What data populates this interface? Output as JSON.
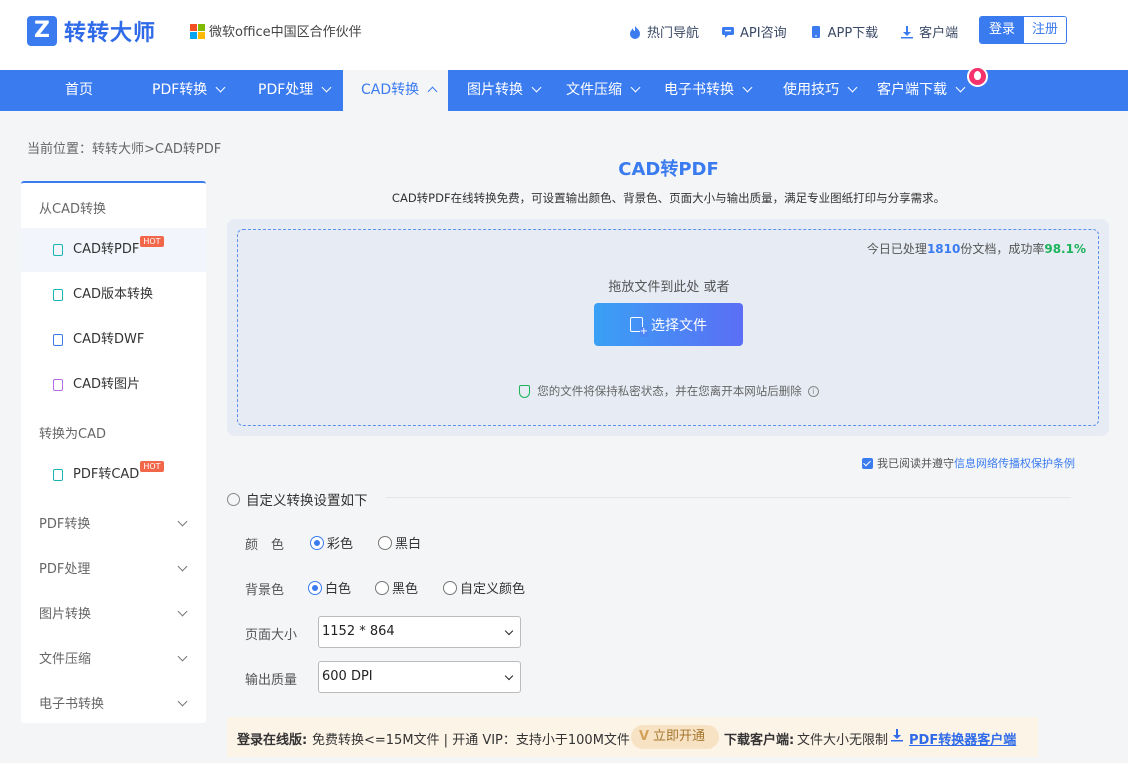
{
  "brand": {
    "name": "转转大师",
    "partner": "微软office中国区合作伙伴"
  },
  "top_links": [
    {
      "label": "热门导航",
      "icon": "fire-icon"
    },
    {
      "label": "API咨询",
      "icon": "chat-icon"
    },
    {
      "label": "APP下载",
      "icon": "phone-icon"
    },
    {
      "label": "客户端",
      "icon": "download-icon"
    }
  ],
  "auth": {
    "login": "登录",
    "register": "注册"
  },
  "nav": [
    {
      "label": "首页"
    },
    {
      "label": "PDF转换"
    },
    {
      "label": "PDF处理"
    },
    {
      "label": "CAD转换"
    },
    {
      "label": "图片转换"
    },
    {
      "label": "文件压缩"
    },
    {
      "label": "电子书转换"
    },
    {
      "label": "使用技巧"
    },
    {
      "label": "客户端下载"
    }
  ],
  "breadcrumb": "当前位置：转转大师>CAD转PDF",
  "sidebar": {
    "group1": "从CAD转换",
    "items1": [
      {
        "label": "CAD转PDF",
        "hot": "HOT"
      },
      {
        "label": "CAD版本转换"
      },
      {
        "label": "CAD转DWF"
      },
      {
        "label": "CAD转图片"
      }
    ],
    "group2": "转换为CAD",
    "items2": [
      {
        "label": "PDF转CAD",
        "hot": "HOT"
      }
    ],
    "collapsed": [
      "PDF转换",
      "PDF处理",
      "图片转换",
      "文件压缩",
      "电子书转换"
    ]
  },
  "main": {
    "title": "CAD转PDF",
    "desc": "CAD转PDF在线转换免费，可设置输出颜色、背景色、页面大小与输出质量，满足专业图纸打印与分享需求。",
    "stats": {
      "prefix": "今日已处理",
      "count": "1810",
      "mid": "份文档，成功率",
      "rate": "98.1%"
    },
    "drop_hint": "拖放文件到此处 或者",
    "select_button": "选择文件",
    "privacy": "您的文件将保持私密状态，并在您离开本网站后删除",
    "agree_prefix": "我已阅读并遵守",
    "agree_link": "信息网络传播权保护条例",
    "settings_title": "自定义转换设置如下",
    "color": {
      "label": "颜　色",
      "options": [
        "彩色",
        "黑白"
      ],
      "selected": "彩色"
    },
    "bg": {
      "label": "背景色",
      "options": [
        "白色",
        "黑色",
        "自定义颜色"
      ],
      "selected": "白色"
    },
    "page_size": {
      "label": "页面大小",
      "value": "1152 * 864"
    },
    "quality": {
      "label": "输出质量",
      "value": "600 DPI"
    }
  },
  "promo": {
    "online_label": "登录在线版:",
    "online_text": "免费转换<=15M文件 | 开通 VIP：支持小于100M文件",
    "vip_button": "立即开通",
    "client_label": "下载客户端:",
    "client_text": "文件大小无限制",
    "client_link": "PDF转换器客户端"
  },
  "colors": {
    "primary": "#3a7bf0",
    "success": "#1cb35a",
    "hot": "#f2664a"
  }
}
